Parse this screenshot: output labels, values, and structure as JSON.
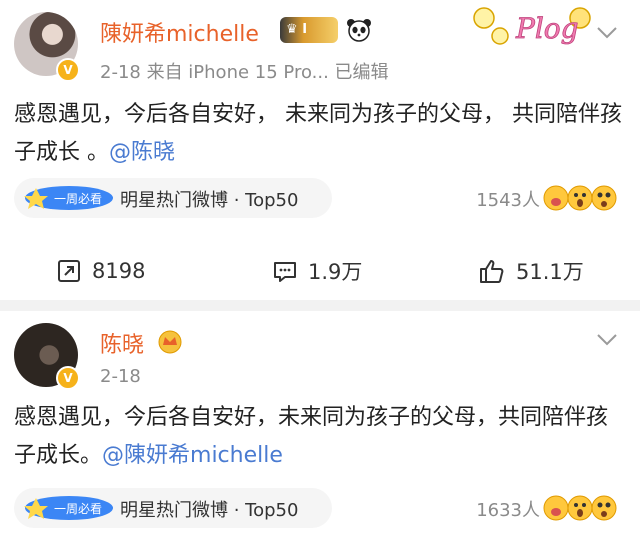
{
  "posts": [
    {
      "author": "陳妍希michelle",
      "vip_label": "I",
      "meta": "2-18   来自 iPhone 15 Pro...   已编辑",
      "text_before": "感恩遇见，今后各自安好，  未来同为孩子的父母，  共同陪伴孩子成长 。",
      "mention": "@陈晓",
      "tag_label": "明星热门微博 · Top50",
      "reactions": "1543人",
      "repost": "8198",
      "comment": "1.9万",
      "like": "51.1万"
    },
    {
      "author": "陈晓",
      "meta": "2-18",
      "text_before": "感恩遇见，今后各自安好，未来同为孩子的父母，共同陪伴孩子成长。",
      "mention": "@陳妍希michelle",
      "tag_label": "明星热门微博 · Top50",
      "reactions": "1633人"
    }
  ],
  "sticker_text": "Plog",
  "tag_logo_text": "一周必看",
  "colors": {
    "name": "#e8622a",
    "mention": "#4a7bd1",
    "meta": "#8a8a8a"
  }
}
